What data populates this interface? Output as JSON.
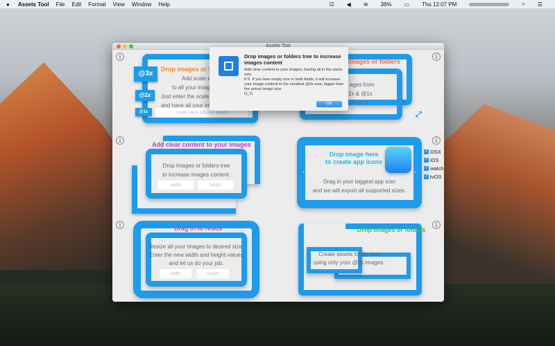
{
  "menubar": {
    "apple": "",
    "app": "Assets Tool",
    "items": [
      "File",
      "Edit",
      "Format",
      "View",
      "Window",
      "Help"
    ],
    "battery": "36%",
    "clock": "Thu 12:07 PM"
  },
  "window": {
    "title": "Assets Tool"
  },
  "panels": {
    "scale": {
      "title": "Drop images or f",
      "lines": [
        "Add scale exte",
        "to all your images",
        "Just enter the scale",
        "and have all your ima"
      ],
      "badges": [
        "@3x",
        "@2x",
        "@1x"
      ],
      "placeholder": "scale value (image value)"
    },
    "generate": {
      "title": "images or folders",
      "lines": [
        "ages from",
        "2x & @1x",
        "⇒ @1x"
      ]
    },
    "clear": {
      "title": "Add clear content to your images",
      "lines": [
        "Drop images or folders tree",
        "to increase images content."
      ],
      "width_placeholder": "width",
      "height_placeholder": "height"
    },
    "appicons": {
      "title_lines": [
        "Drop image here",
        "to create app icons"
      ],
      "lines": [
        "Drag in your biggest app icon",
        "and we will export all supported sizes."
      ],
      "platforms": [
        "OSX",
        "iOS",
        "watch",
        "tvOS"
      ]
    },
    "resize": {
      "title": "Drag in to resize",
      "lines": [
        "Resize all your images to desired size.",
        "Enter the new width and height values",
        "and let us do your job."
      ],
      "width_placeholder": "width",
      "height_placeholder": "height"
    },
    "folders": {
      "title": "Drop images or folders",
      "lines": [
        "Create assets folder tree",
        "using only your @3x images."
      ]
    }
  },
  "dialog": {
    "title": "Drop images or folders tree to increase images content",
    "body": [
      "Add clear content to your images, having all in the same size.",
      "P.S. If you leve empty one or both fields, it will increase your image content to the smallest @3x size, bigger than the actual image size.",
      "O_O"
    ],
    "ok": "OK"
  },
  "colors": {
    "accent": "#1d9bec",
    "orange": "#f5861f",
    "purple": "#b638d6",
    "teal": "#1fb8d8",
    "pink": "#f0407a",
    "green": "#3dbb4a"
  }
}
